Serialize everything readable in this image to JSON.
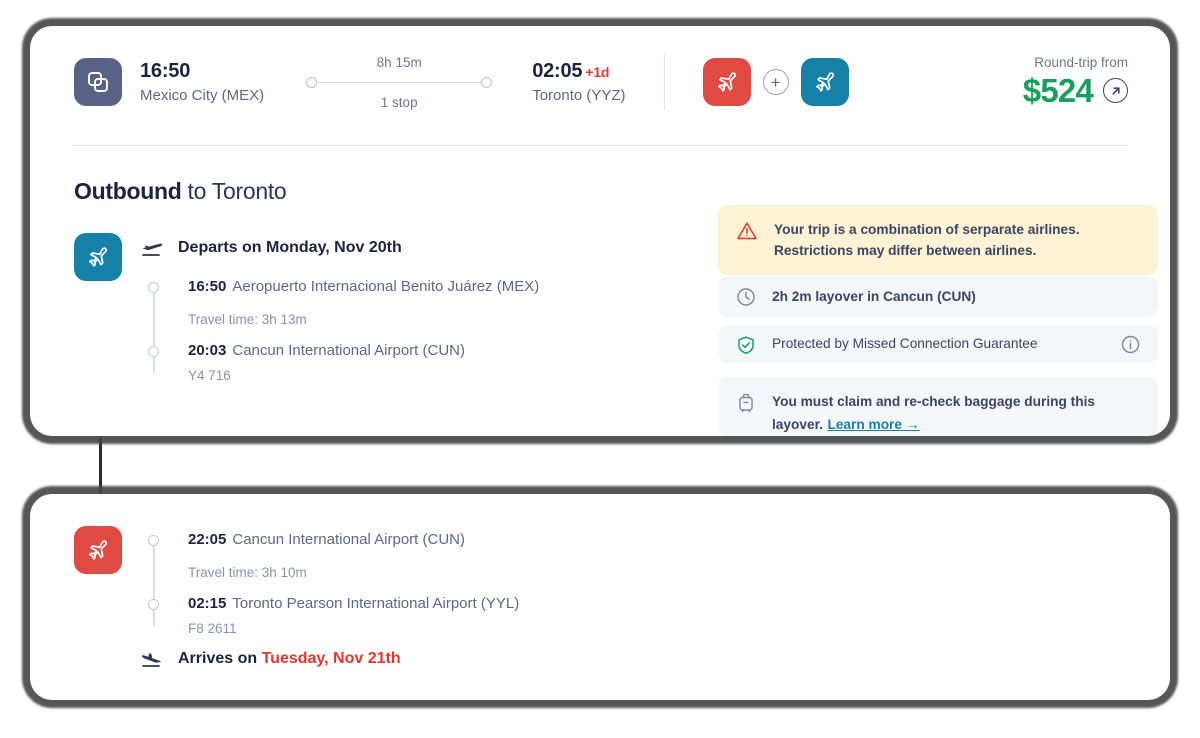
{
  "header": {
    "multi_airline_icon": "layers-icon",
    "departure": {
      "time": "16:50",
      "city": "Mexico City (MEX)"
    },
    "duration": "8h 15m",
    "stops": "1 stop",
    "arrival": {
      "time": "02:05",
      "plus_day": "+1d",
      "city": "Toronto (YYZ)"
    },
    "airlines": [
      {
        "icon": "airplane-icon",
        "color": "#e04a43"
      },
      {
        "icon": "airplane-icon",
        "color": "#1581a8"
      }
    ],
    "plus_icon": "plus-circle-icon",
    "price_label": "Round-trip from",
    "price_value": "$524",
    "price_arrow_icon": "arrow-up-right-icon"
  },
  "outbound": {
    "title_bold": "Outbound",
    "title_rest": " to Toronto",
    "leg": {
      "tile_color": "#1581a8",
      "tile_icon": "airplane-icon",
      "depart_icon": "takeoff-icon",
      "depart_label": "Departs on Monday, Nov 20th",
      "stops": [
        {
          "time": "16:50",
          "airport": "Aeropuerto Internacional Benito Juárez (MEX)"
        },
        {
          "time": "20:03",
          "airport": "Cancun International Airport (CUN)"
        }
      ],
      "travel_time": "Travel time: 3h 13m",
      "flight_number": "Y4 716"
    }
  },
  "panels": {
    "warning": {
      "icon": "warning-triangle-icon",
      "line1": "Your trip is a combination of serparate airlines.",
      "line2": "Restrictions may differ between airlines."
    },
    "layover": {
      "icon": "clock-icon",
      "text": "2h 2m layover in Cancun (CUN)"
    },
    "guarantee": {
      "icon": "shield-check-icon",
      "text": "Protected by Missed Connection Guarantee",
      "info_icon": "info-circle-icon"
    },
    "baggage": {
      "icon": "suitcase-icon",
      "text": "You must claim and re-check baggage during this layover.",
      "link_label": "Learn more →"
    }
  },
  "second_leg": {
    "tile_color": "#e04a43",
    "tile_icon": "airplane-icon",
    "stops": [
      {
        "time": "22:05",
        "airport": "Cancun International Airport (CUN)"
      },
      {
        "time": "02:15",
        "airport": "Toronto Pearson International Airport (YYL)"
      }
    ],
    "travel_time": "Travel time: 3h 10m",
    "flight_number": "F8 2611",
    "arrive_icon": "landing-icon",
    "arrive_label": "Arrives on ",
    "arrive_date": "Tuesday, Nov 21th"
  },
  "colors": {
    "navy": "#1c2340",
    "muted": "#5e6886",
    "red": "#e8352b",
    "green": "#17a05c",
    "teal": "#1581a8",
    "warning_bg": "#fdf2d4",
    "panel_bg": "#f4f6fa"
  }
}
